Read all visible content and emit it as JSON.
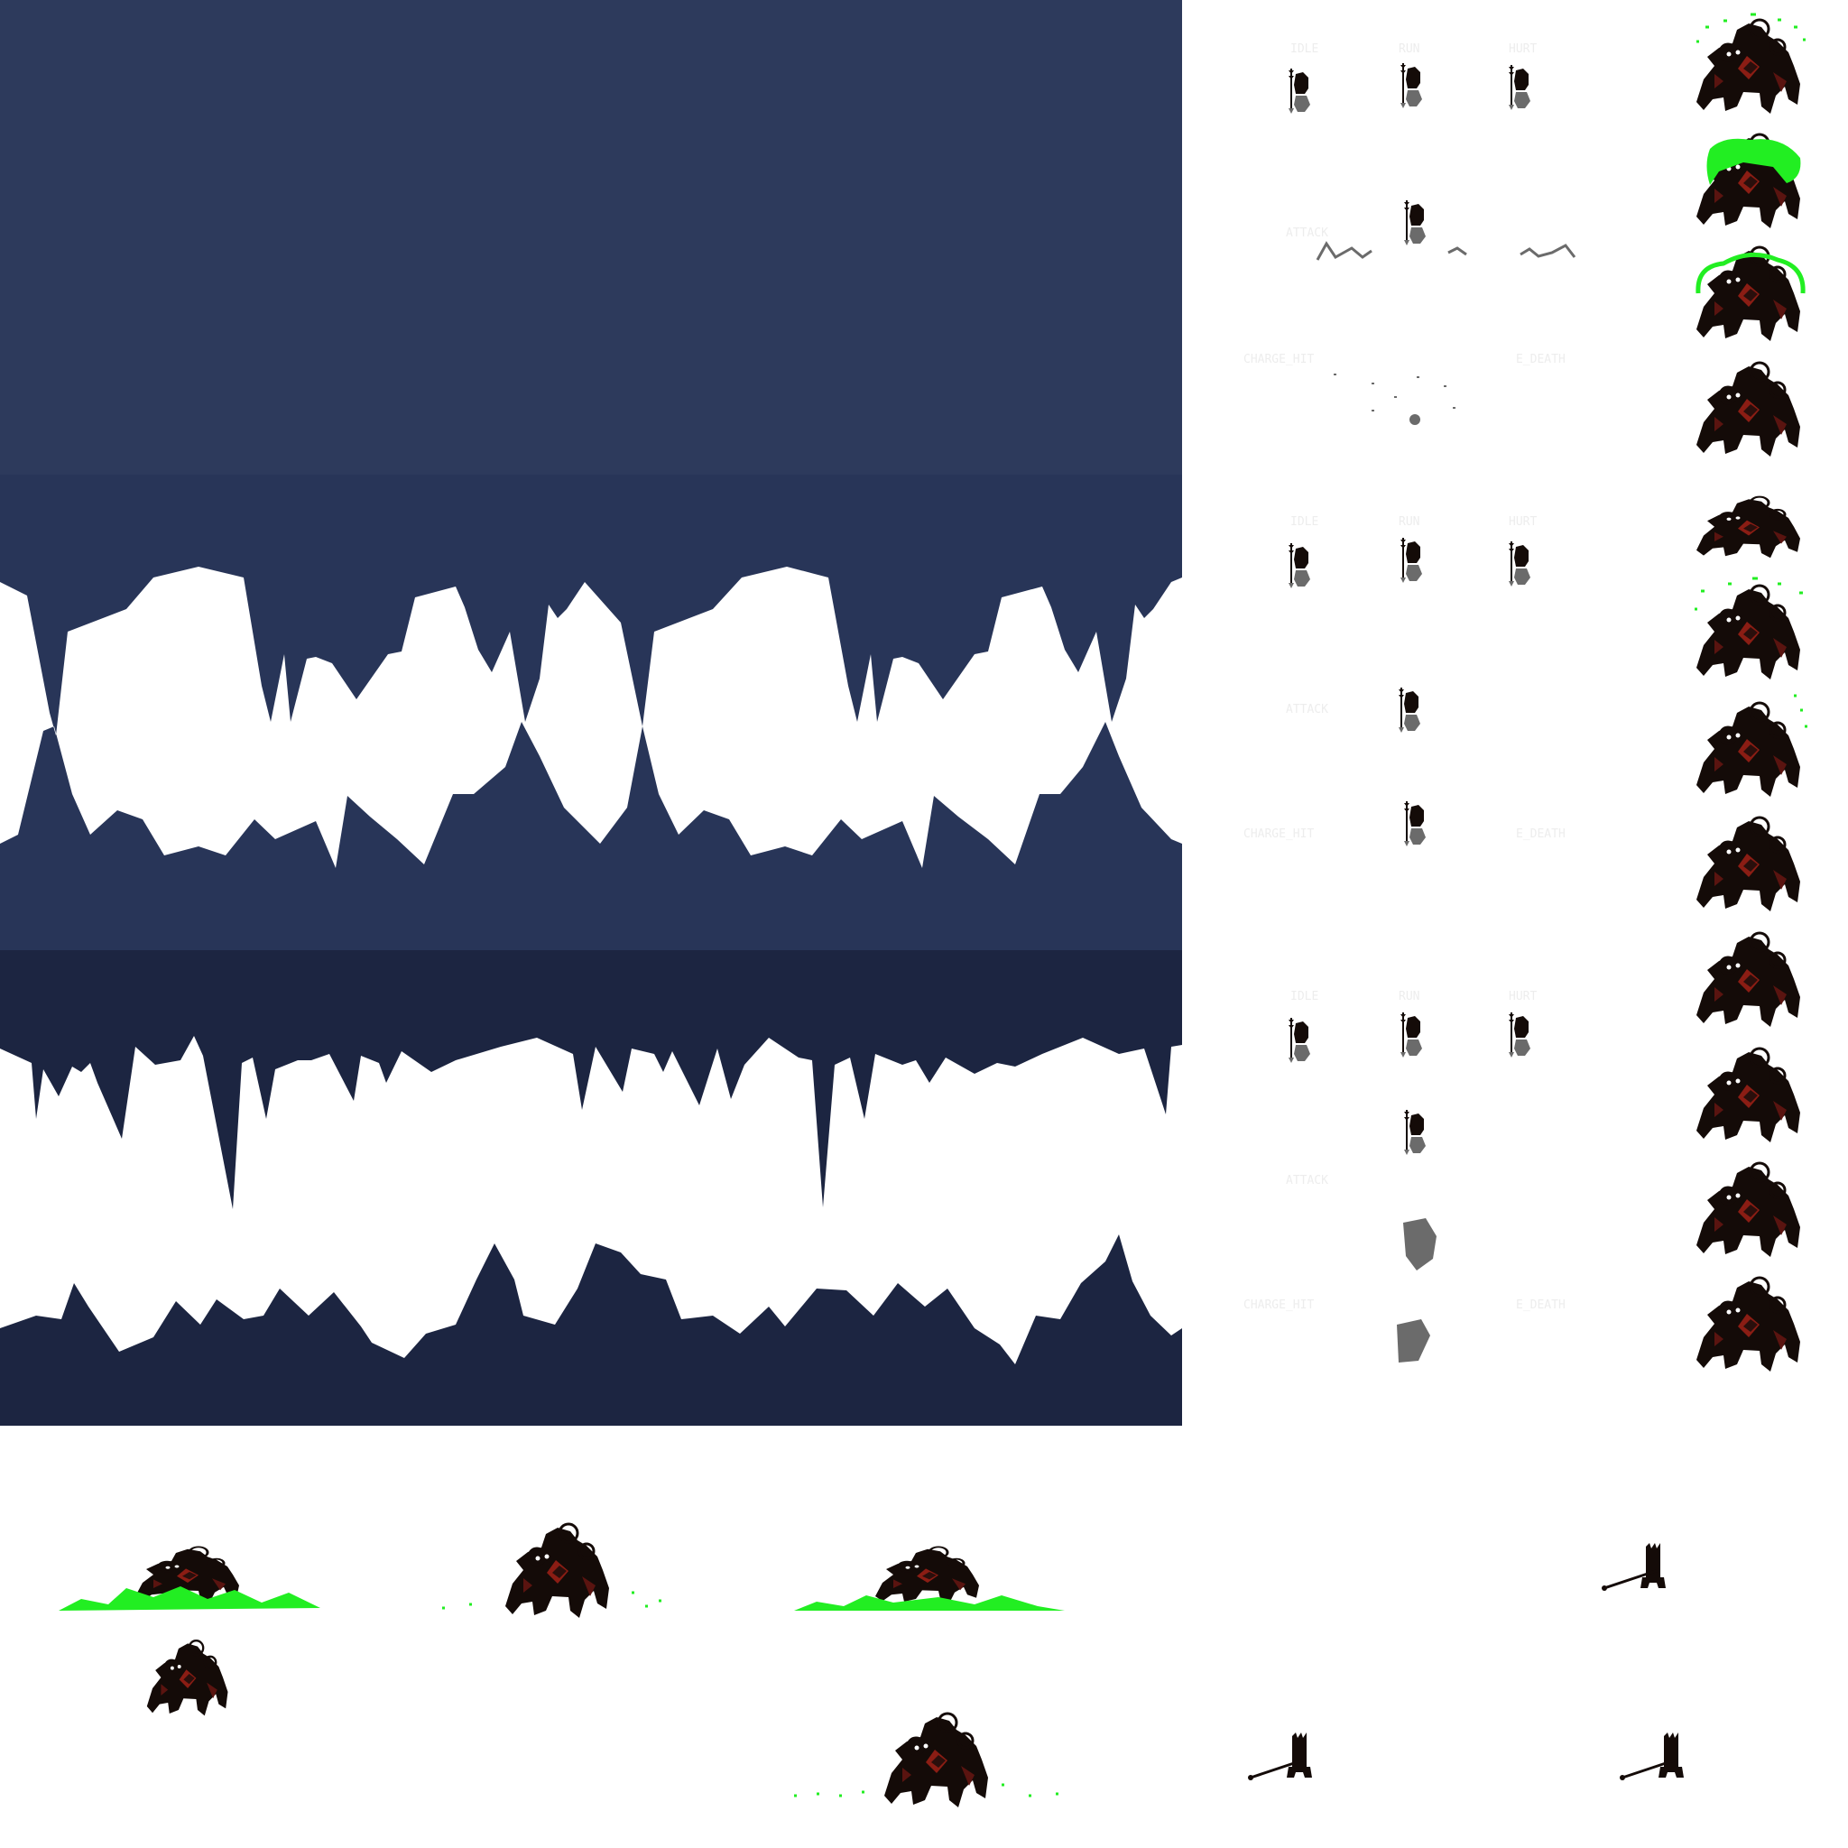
{
  "sheet": {
    "colors": {
      "band_top": "#2d3a5c",
      "band_mid": "#283558",
      "band_low": "#1c2541",
      "cave_void": "#ffffff",
      "sprite_dark": "#140b08",
      "sprite_red": "#8b1d14",
      "glow_green": "#22ee22",
      "ghost_gray": "#6b6b6b",
      "label_faint": "#ededed"
    },
    "bands": [
      {
        "name": "cave-band-top",
        "content": "solid"
      },
      {
        "name": "cave-band-mid",
        "content": "cave-opening"
      },
      {
        "name": "cave-band-low",
        "content": "icicle-cavern"
      }
    ],
    "sections": [
      {
        "labels": [
          "IDLE",
          "RUN",
          "HURT",
          "ATTACK",
          "CHARGE_HIT",
          "E_DEATH"
        ]
      },
      {
        "labels": [
          "IDLE",
          "RUN",
          "HURT",
          "ATTACK",
          "CHARGE_HIT",
          "E_DEATH"
        ]
      },
      {
        "labels": [
          "IDLE",
          "RUN",
          "HURT",
          "ATTACK",
          "CHARGE_HIT",
          "E_DEATH"
        ]
      }
    ],
    "boss_frames": [
      {
        "effect": "spark"
      },
      {
        "effect": "aura"
      },
      {
        "effect": "ring"
      },
      {
        "effect": "none"
      },
      {
        "effect": "crouch"
      },
      {
        "effect": "spark"
      },
      {
        "effect": "dots"
      },
      {
        "effect": "none"
      },
      {
        "effect": "none"
      },
      {
        "effect": "none"
      },
      {
        "effect": "none"
      },
      {
        "effect": "none"
      }
    ],
    "bottom_frames": [
      {
        "type": "boss-emerge",
        "effect": "ground-burst"
      },
      {
        "type": "boss",
        "effect": "sparse-dots"
      },
      {
        "type": "boss-emerge",
        "effect": "ground-burst"
      },
      {
        "type": "hero-spear",
        "effect": "none"
      },
      {
        "type": "boss-small",
        "effect": "none"
      },
      {
        "type": "boss",
        "effect": "dots"
      },
      {
        "type": "hero-spear",
        "effect": "none"
      },
      {
        "type": "hero-spear",
        "effect": "none"
      }
    ]
  }
}
